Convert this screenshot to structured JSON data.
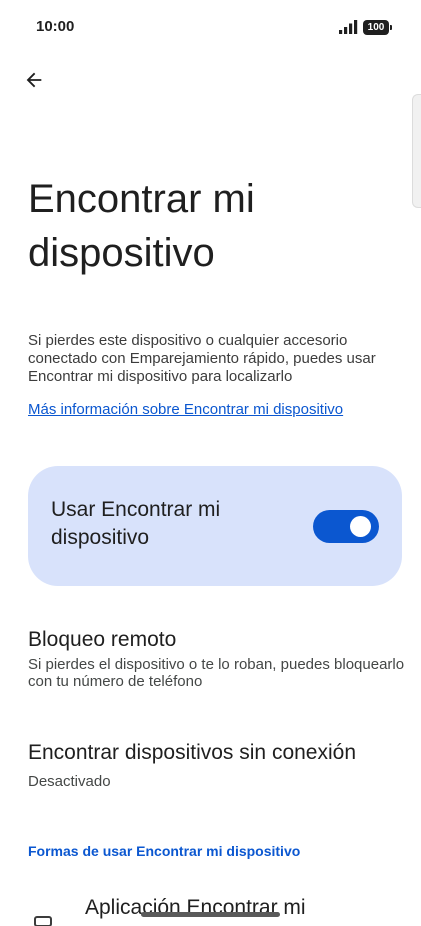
{
  "status_bar": {
    "time": "10:00",
    "battery": "100"
  },
  "header": {
    "back_icon": "arrow-back-icon",
    "title": "Encontrar mi dispositivo"
  },
  "intro": {
    "description": "Si pierdes este dispositivo o cualquier accesorio conectado con Emparejamiento rápido, puedes usar Encontrar mi dispositivo para localizarlo",
    "learn_more": "Más información sobre Encontrar mi dispositivo"
  },
  "main_toggle": {
    "label": "Usar Encontrar mi dispositivo",
    "enabled": true
  },
  "settings": {
    "remote_lock": {
      "title": "Bloqueo remoto",
      "summary": "Si pierdes el dispositivo o te lo roban, puedes bloquearlo con tu número de teléfono"
    },
    "offline_devices": {
      "title": "Encontrar dispositivos sin conexión",
      "summary": "Desactivado"
    }
  },
  "ways_section": {
    "header": "Formas de usar Encontrar mi dispositivo",
    "app_item": {
      "title": "Aplicación Encontrar mi",
      "icon": "phone-icon"
    }
  },
  "colors": {
    "accent": "#0b57d0",
    "card_background": "#d8e2fb"
  }
}
